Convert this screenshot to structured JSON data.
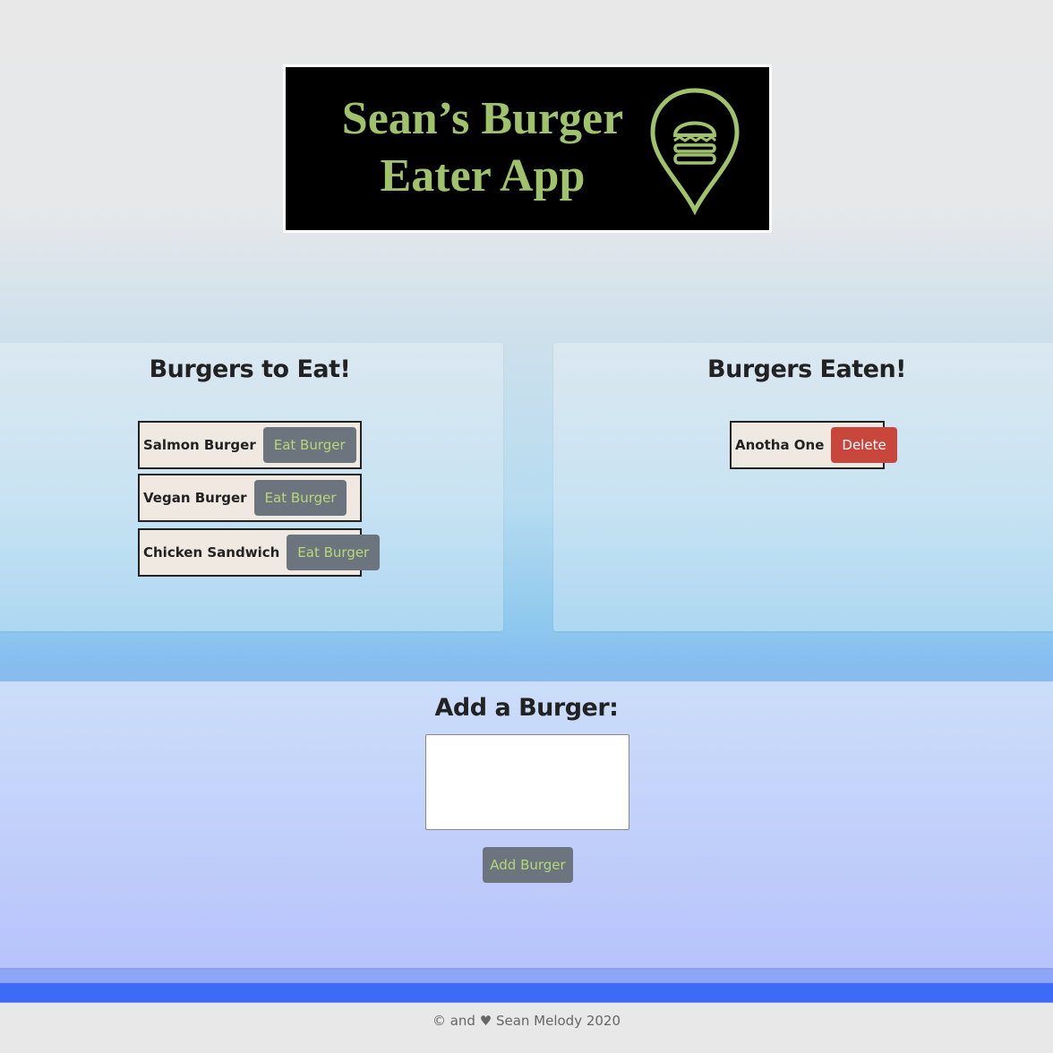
{
  "logo": {
    "line1": "Sean’s Burger",
    "line2": "Eater App",
    "icon": "burger-pin-icon",
    "color": "#9fc26b"
  },
  "to_eat": {
    "title": "Burgers to Eat!",
    "items": [
      {
        "name": "Salmon Burger",
        "button": "Eat Burger"
      },
      {
        "name": "Vegan Burger",
        "button": "Eat Burger"
      },
      {
        "name": "Chicken Sandwich",
        "button": "Eat Burger"
      }
    ]
  },
  "eaten": {
    "title": "Burgers Eaten!",
    "items": [
      {
        "name": "Anotha One",
        "button": "Delete"
      }
    ]
  },
  "add": {
    "title": "Add a Burger:",
    "input_value": "",
    "button": "Add Burger"
  },
  "footer": {
    "text": "© and ♥ Sean Melody 2020"
  },
  "colors": {
    "button_gray": "#6c757d",
    "button_text_green": "#b6d77a",
    "delete_red": "#c9463d",
    "footer_bar": "#3d6bf7"
  }
}
